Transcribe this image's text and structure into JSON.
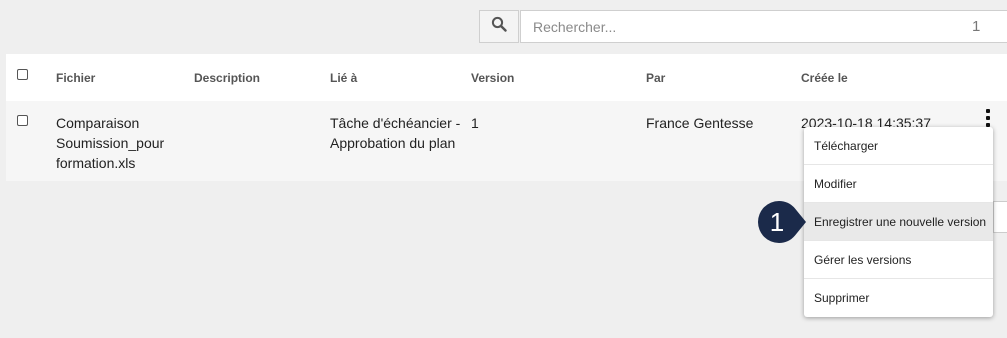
{
  "search": {
    "placeholder": "Rechercher...",
    "count": "1"
  },
  "table": {
    "headers": {
      "fichier": "Fichier",
      "description": "Description",
      "lie_a": "Lié à",
      "version": "Version",
      "par": "Par",
      "creee_le": "Créée le"
    },
    "rows": [
      {
        "fichier_lines": [
          "Comparaison",
          "Soumission_pour",
          "formation.xls"
        ],
        "description": "",
        "lie_a_lines": [
          "Tâche d'échéancier -",
          "Approbation du plan"
        ],
        "version": "1",
        "par": "France Gentesse",
        "creee_le": "2023-10-18 14:35:37"
      }
    ]
  },
  "menu": {
    "items": [
      "Télécharger",
      "Modifier",
      "Enregistrer une nouvelle version",
      "Gérer les versions",
      "Supprimer"
    ],
    "highlighted_index": 2
  },
  "step_badge": {
    "label": "1",
    "color": "#1b2a4a"
  },
  "icons": {
    "search": "search-icon",
    "more": "kebab-menu-icon"
  }
}
